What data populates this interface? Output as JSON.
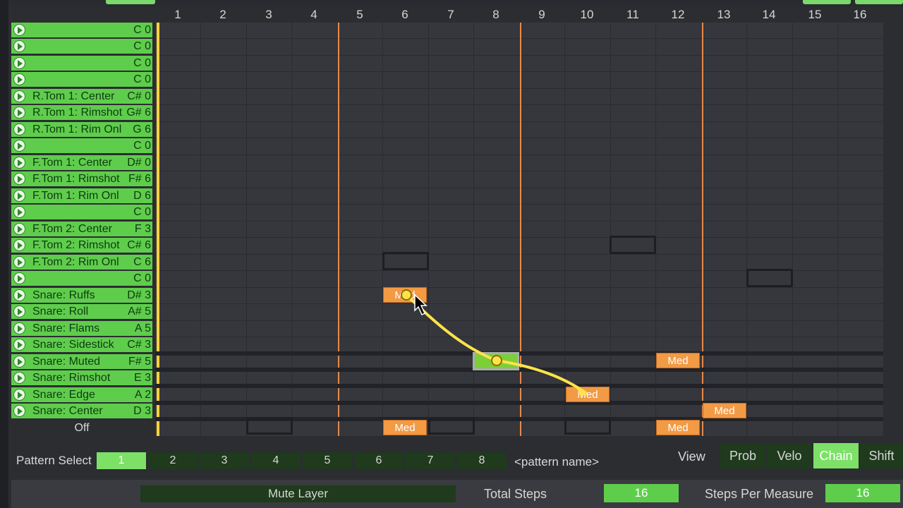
{
  "columns": [
    "1",
    "2",
    "3",
    "4",
    "5",
    "6",
    "7",
    "8",
    "9",
    "10",
    "11",
    "12",
    "13",
    "14",
    "15",
    "16"
  ],
  "rows": [
    {
      "name": "",
      "note": "C 0"
    },
    {
      "name": "",
      "note": "C 0"
    },
    {
      "name": "",
      "note": "C 0"
    },
    {
      "name": "",
      "note": "C 0"
    },
    {
      "name": "R.Tom 1: Center",
      "note": "C# 0"
    },
    {
      "name": "R.Tom 1: Rimshot",
      "note": "G# 6"
    },
    {
      "name": "R.Tom 1: Rim Onl",
      "note": "G 6"
    },
    {
      "name": "",
      "note": "C 0"
    },
    {
      "name": "F.Tom 1: Center",
      "note": "D# 0"
    },
    {
      "name": "F.Tom 1: Rimshot",
      "note": "F# 6"
    },
    {
      "name": "F.Tom 1: Rim Onl",
      "note": "D 6"
    },
    {
      "name": "",
      "note": "C 0"
    },
    {
      "name": "F.Tom 2: Center",
      "note": "F 3"
    },
    {
      "name": "F.Tom 2: Rimshot",
      "note": "C# 6"
    },
    {
      "name": "F.Tom 2: Rim Onl",
      "note": "C 6"
    },
    {
      "name": "",
      "note": "C 0"
    },
    {
      "name": "Snare: Ruffs",
      "note": "D# 3"
    },
    {
      "name": "Snare: Roll",
      "note": "A# 5"
    },
    {
      "name": "Snare: Flams",
      "note": "A 5"
    },
    {
      "name": "Snare: Sidestick",
      "note": "C# 3"
    },
    {
      "name": "Snare: Muted",
      "note": "F# 5"
    },
    {
      "name": "Snare: Rimshot",
      "note": "E 3"
    },
    {
      "name": "Snare: Edge",
      "note": "A 2"
    },
    {
      "name": "Snare: Center",
      "note": "D 3"
    }
  ],
  "off_label": "Off",
  "steps": {
    "ruffs_6": "Med",
    "edge_10": "Med",
    "muted_12": "Med",
    "center_13": "Med",
    "off_6": "Med",
    "off_12": "Med"
  },
  "pattern": {
    "label": "Pattern Select",
    "buttons": [
      "1",
      "2",
      "3",
      "4",
      "5",
      "6",
      "7",
      "8"
    ],
    "name_placeholder": "<pattern name>"
  },
  "view": {
    "label": "View",
    "buttons": [
      "Prob",
      "Velo",
      "Chain",
      "Shift"
    ],
    "active": "Chain"
  },
  "footer": {
    "mute_layer": "Mute Layer",
    "total_steps_label": "Total Steps",
    "total_steps_value": "16",
    "steps_per_measure_label": "Steps Per Measure",
    "steps_per_measure_value": "16"
  },
  "colors": {
    "accent_green": "#7de067",
    "step_orange": "#f39a45",
    "chain_yellow": "#ffe34a",
    "measure_line": "#e8894a"
  }
}
